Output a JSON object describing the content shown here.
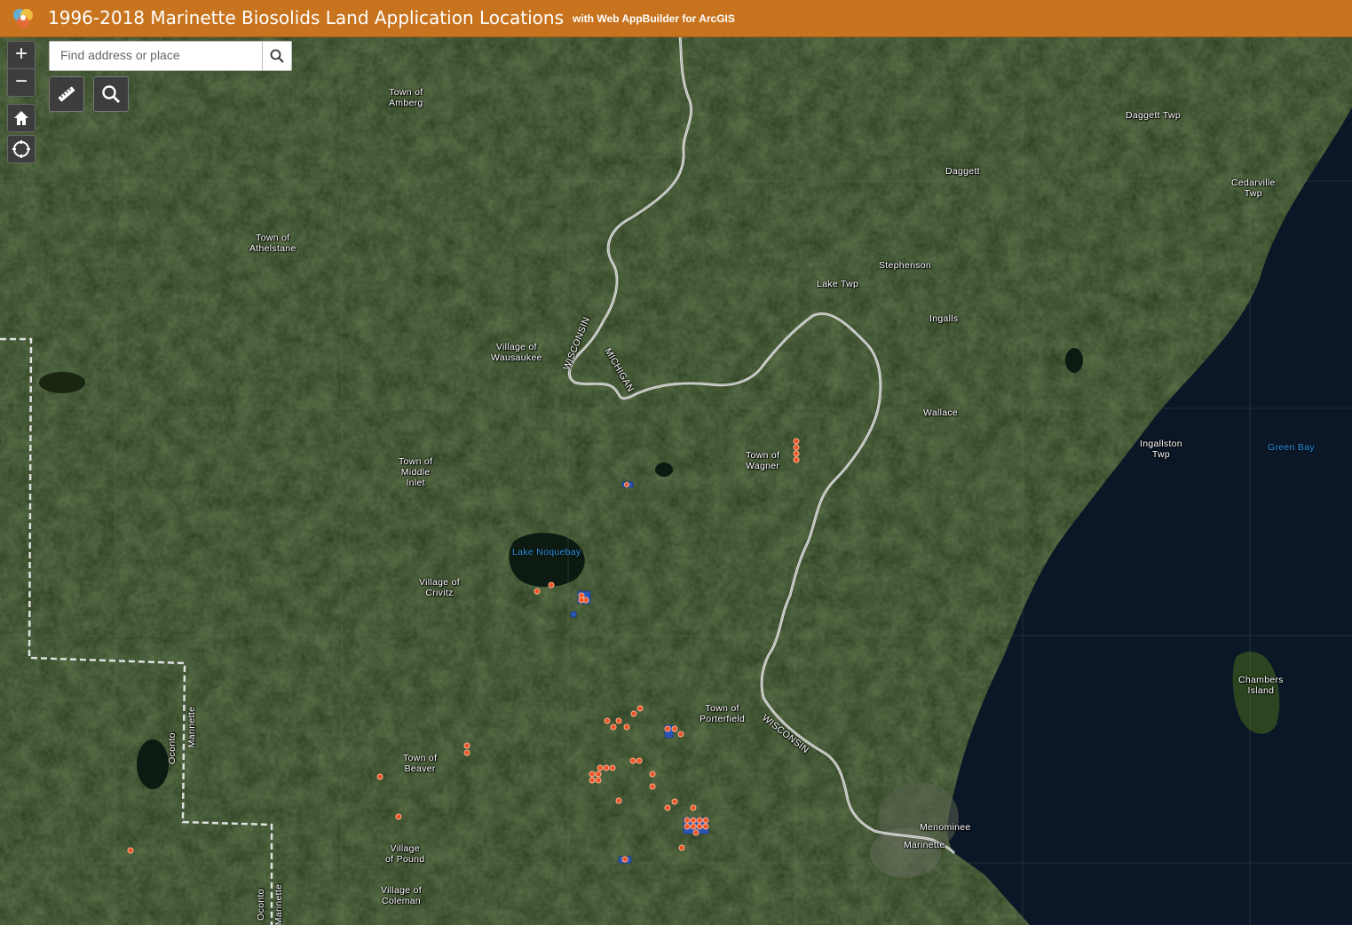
{
  "header": {
    "title": "1996-2018 Marinette Biosolids Land Application Locations",
    "subtitle": "with Web AppBuilder for ArcGIS",
    "background": "#c8741f"
  },
  "search": {
    "placeholder": "Find address or place",
    "value": ""
  },
  "controls": {
    "zoom_in": "+",
    "zoom_out": "−",
    "icons": [
      "measure-icon",
      "search-icon",
      "home-icon",
      "locate-icon"
    ]
  },
  "map": {
    "colors": {
      "land": "#22361a",
      "water": "#0b1726",
      "border_line": "#d9d9d9",
      "site_marker": "#e8532a",
      "site_parcel": "#2a57b5"
    },
    "place_labels": [
      "Town of\nAmberg",
      "Daggett Twp",
      "Daggett",
      "Cedarville\nTwp",
      "Town of\nAthelstane",
      "Stephenson",
      "Lake Twp",
      "Ingalls",
      "Village of\nWausaukee",
      "Wallace",
      "Ingallston\nTwp",
      "Town of\nMiddle\nInlet",
      "Town of\nWagner",
      "Village of\nCrivitz",
      "Town of\nPorterfield",
      "Chambers\nIsland",
      "Town of\nBeaver",
      "Menominee",
      "Marinette",
      "Village\nof Pound",
      "Village of\nColeman"
    ],
    "water_labels": [
      "Green Bay",
      "Lake Noquebay"
    ],
    "boundary_labels": [
      "WISCONSIN",
      "MICHIGAN",
      "WISCONSIN"
    ],
    "county_labels": [
      "Oconto",
      "Marinette",
      "Oconto",
      "Marinette"
    ]
  }
}
